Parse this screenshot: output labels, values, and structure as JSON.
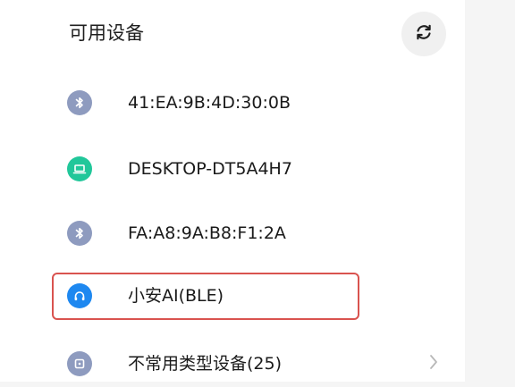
{
  "header": {
    "title": "可用设备",
    "refresh_icon": "refresh-icon"
  },
  "devices": [
    {
      "label": "41:EA:9B:4D:30:0B",
      "icon": "bluetooth-icon",
      "icon_color": "#8e9bbf"
    },
    {
      "label": "DESKTOP-DT5A4H7",
      "icon": "laptop-icon",
      "icon_color": "#21c79a"
    },
    {
      "label": "FA:A8:9A:B8:F1:2A",
      "icon": "bluetooth-icon",
      "icon_color": "#8e9bbf"
    },
    {
      "label": "小安AI(BLE)",
      "icon": "headphones-icon",
      "icon_color": "#1e88f0",
      "highlighted": true
    },
    {
      "label": "不常用类型设备(25)",
      "icon": "square-icon",
      "icon_color": "#8e9bbf",
      "chevron": "chevron-right-icon"
    }
  ],
  "colors": {
    "highlight_border": "#d9534f",
    "panel_bg": "#ffffff"
  }
}
